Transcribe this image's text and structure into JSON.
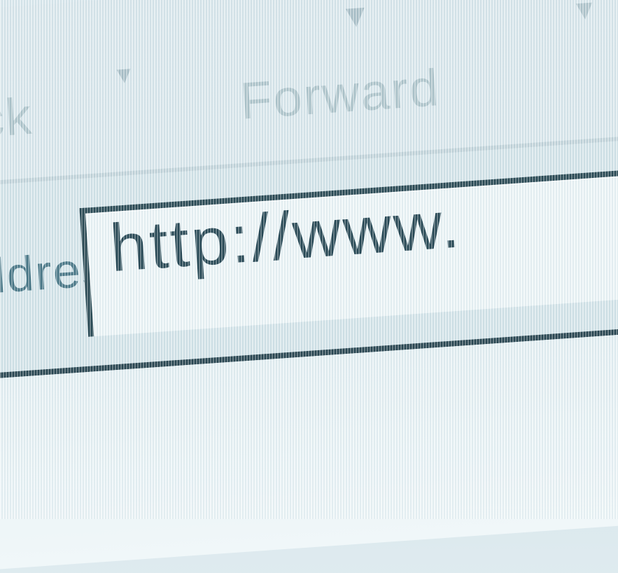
{
  "toolbar": {
    "back_label": "Back",
    "forward_label": "Forward",
    "back_arrow": "▼",
    "forward_arrow": "▼",
    "dropdown_arrow": "▼"
  },
  "address_bar": {
    "label": "Address",
    "value": "http://www."
  },
  "colors": {
    "background": "#dce9ee",
    "text_dark": "#1c3d4a",
    "text_faded": "#aec3ca"
  }
}
